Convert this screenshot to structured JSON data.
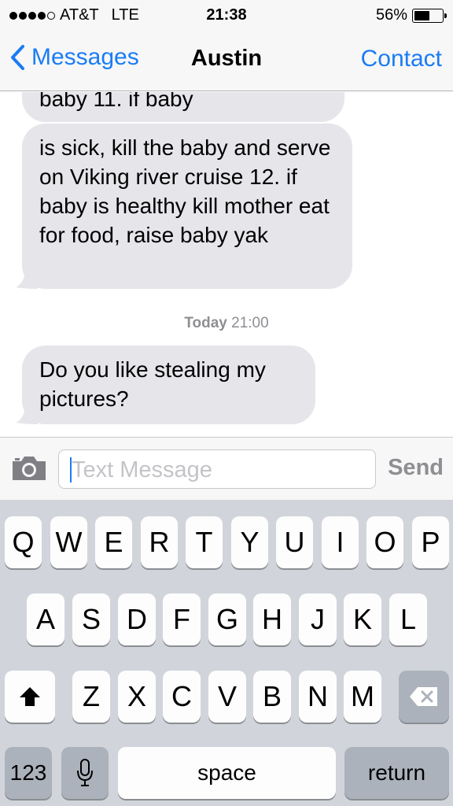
{
  "status": {
    "carrier": "AT&T",
    "network": "LTE",
    "time": "21:38",
    "battery": "56%",
    "battery_level": 0.56
  },
  "nav": {
    "back_label": "Messages",
    "title": "Austin",
    "contact_label": "Contact"
  },
  "messages": [
    {
      "text": "baby 11. if baby"
    },
    {
      "text": "is sick, kill the baby and serve on Viking river cruise 12. if baby is healthy kill mother eat for food, raise baby yak"
    },
    {
      "text": "Do you like stealing my pictures?"
    }
  ],
  "timestamp": {
    "day": "Today",
    "time": "21:00"
  },
  "input": {
    "placeholder": "Text Message",
    "send_label": "Send",
    "camera_icon": "camera-icon"
  },
  "keyboard": {
    "row1": [
      "Q",
      "W",
      "E",
      "R",
      "T",
      "Y",
      "U",
      "I",
      "O",
      "P"
    ],
    "row2": [
      "A",
      "S",
      "D",
      "F",
      "G",
      "H",
      "J",
      "K",
      "L"
    ],
    "row3": [
      "Z",
      "X",
      "C",
      "V",
      "B",
      "N",
      "M"
    ],
    "numbers_label": "123",
    "space_label": "space",
    "return_label": "return",
    "shift_icon": "shift-icon",
    "mic_icon": "microphone-icon",
    "delete_icon": "backspace-icon"
  },
  "colors": {
    "accent": "#1a7cf5",
    "bubble": "#e5e5ea",
    "keyboard_bg": "#d1d5db"
  }
}
